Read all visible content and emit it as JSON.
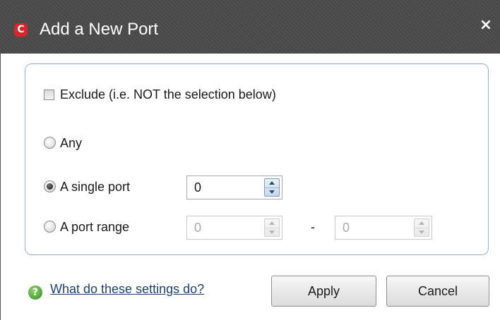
{
  "window": {
    "title": "Add a New Port",
    "app_icon_glyph": "C",
    "app_icon_color": "#d8242c",
    "close_glyph": "×"
  },
  "form": {
    "exclude_label": "Exclude (i.e. NOT the selection below)",
    "exclude_checked": false,
    "selected_option": "single",
    "any_label": "Any",
    "single_label": "A single port",
    "single_value": "0",
    "range_label": "A port range",
    "range_from": "0",
    "range_separator": "-",
    "range_to": "0"
  },
  "footer": {
    "help_icon_glyph": "?",
    "help_link": "What do these settings do?",
    "apply_label": "Apply",
    "cancel_label": "Cancel"
  },
  "colors": {
    "titlebar": "#4a4a4a",
    "group_border": "#8fb1d6",
    "help_icon": "#3f9f2b",
    "link": "#1f3f7a"
  }
}
